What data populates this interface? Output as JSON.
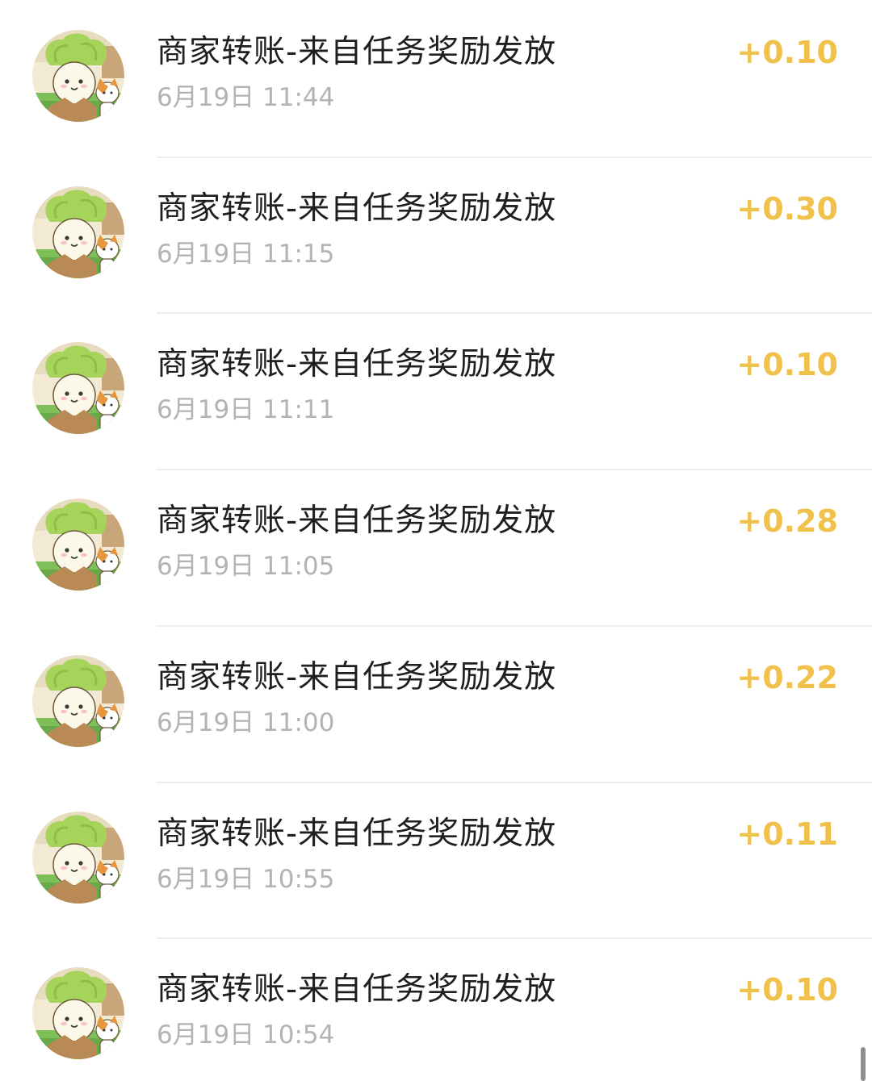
{
  "transactions": [
    {
      "title": "商家转账-来自任务奖励发放",
      "time": "6月19日 11:44",
      "amount": "+0.10",
      "avatar": "cabbage-mascot-avatar"
    },
    {
      "title": "商家转账-来自任务奖励发放",
      "time": "6月19日 11:15",
      "amount": "+0.30",
      "avatar": "cabbage-mascot-avatar"
    },
    {
      "title": "商家转账-来自任务奖励发放",
      "time": "6月19日 11:11",
      "amount": "+0.10",
      "avatar": "cabbage-mascot-avatar"
    },
    {
      "title": "商家转账-来自任务奖励发放",
      "time": "6月19日 11:05",
      "amount": "+0.28",
      "avatar": "cabbage-mascot-avatar"
    },
    {
      "title": "商家转账-来自任务奖励发放",
      "time": "6月19日 11:00",
      "amount": "+0.22",
      "avatar": "cabbage-mascot-avatar"
    },
    {
      "title": "商家转账-来自任务奖励发放",
      "time": "6月19日 10:55",
      "amount": "+0.11",
      "avatar": "cabbage-mascot-avatar"
    },
    {
      "title": "商家转账-来自任务奖励发放",
      "time": "6月19日 10:54",
      "amount": "+0.10",
      "avatar": "cabbage-mascot-avatar"
    }
  ],
  "colors": {
    "amount": "#f0c24b",
    "title": "#1f1f1f",
    "time": "#b3b3b3",
    "separator": "#ededed"
  }
}
